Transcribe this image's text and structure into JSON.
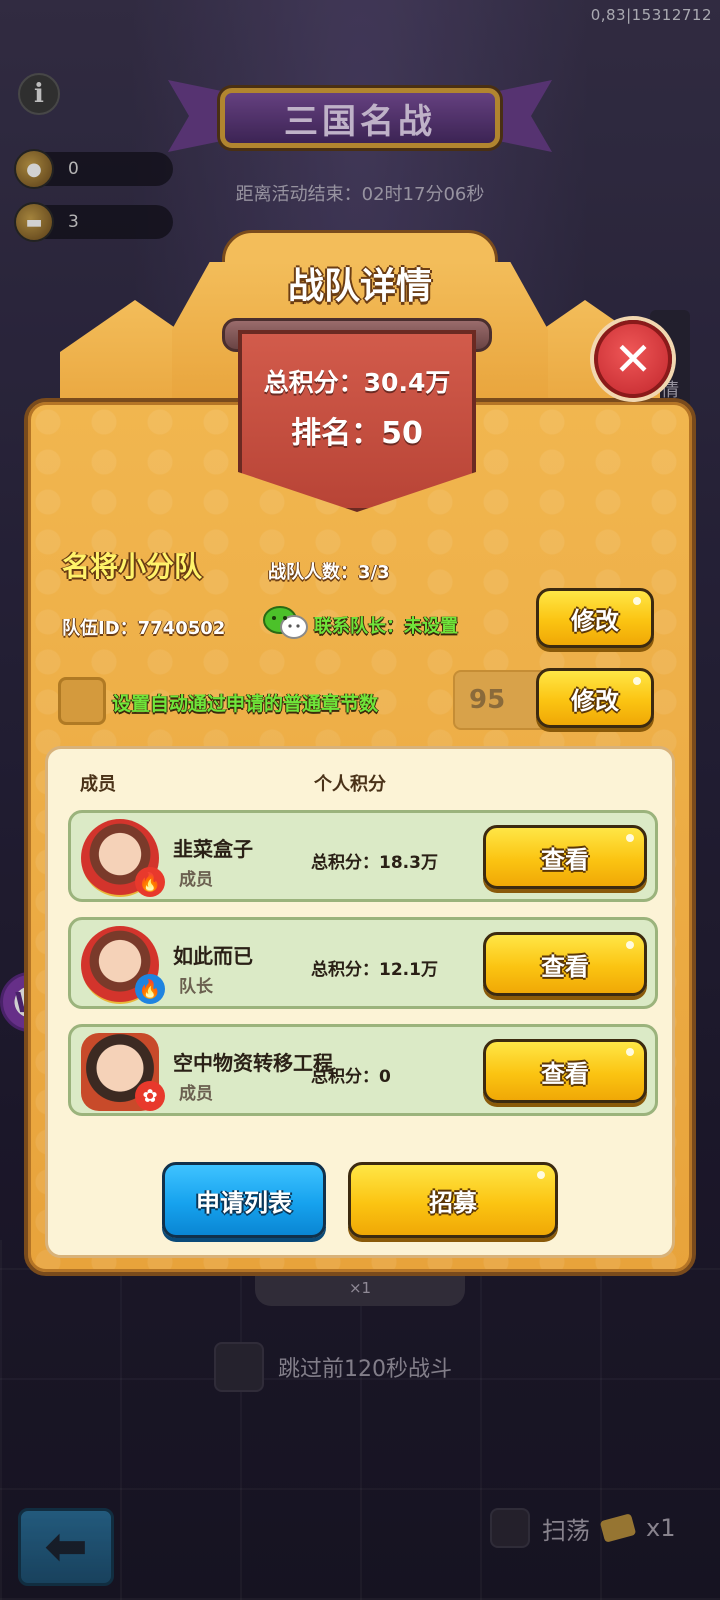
{
  "status": {
    "version_text": "0,83|15312712"
  },
  "background": {
    "info_icon": "info-icon",
    "resources": [
      {
        "icon": "coin-bag-icon",
        "value": "0"
      },
      {
        "icon": "ticket-icon",
        "value": "3"
      }
    ],
    "event_title": "三国名战",
    "countdown": "距离活动结束：02时17分06秒",
    "cost_label": "×1",
    "skip_label": "跳过前120秒战斗",
    "sweep_label": "扫荡",
    "sweep_cost": "x1",
    "side_tab_char": "情",
    "side_logo_text": "W"
  },
  "dialog": {
    "title": "战队详情",
    "total_score": "总积分：30.4万",
    "rank": "排名：50",
    "close_icon": "close-icon",
    "team_name": "名将小分队",
    "member_count": "战队人数：3/3",
    "team_id": "队伍ID：7740502",
    "contact_icon": "wechat-icon",
    "contact": "联系队长：未设置",
    "modify_label": "修改",
    "auto_approve_label": "设置自动通过申请的普通章节数",
    "auto_approve_value": "95",
    "auto_modify_label": "修改",
    "list_headers": {
      "member": "成员",
      "score": "个人积分"
    },
    "members": [
      {
        "name": "韭菜盒子",
        "role": "成员",
        "score": "总积分：18.3万",
        "button": "查看",
        "badge_icon": "fire-icon"
      },
      {
        "name": "如此而已",
        "role": "队长",
        "score": "总积分：12.1万",
        "button": "查看",
        "badge_icon": "flame-icon"
      },
      {
        "name": "空中物资转移工程",
        "role": "成员",
        "score": "总积分：0",
        "button": "查看",
        "badge_icon": "paw-icon"
      }
    ],
    "apply_list_label": "申请列表",
    "recruit_label": "招募"
  },
  "colors": {
    "accent_yellow": "#fbc412",
    "accent_blue": "#16a2ee",
    "panel_orange": "#e8a33b",
    "banner_red": "#c84a3c",
    "green_text": "#6fe53a"
  }
}
